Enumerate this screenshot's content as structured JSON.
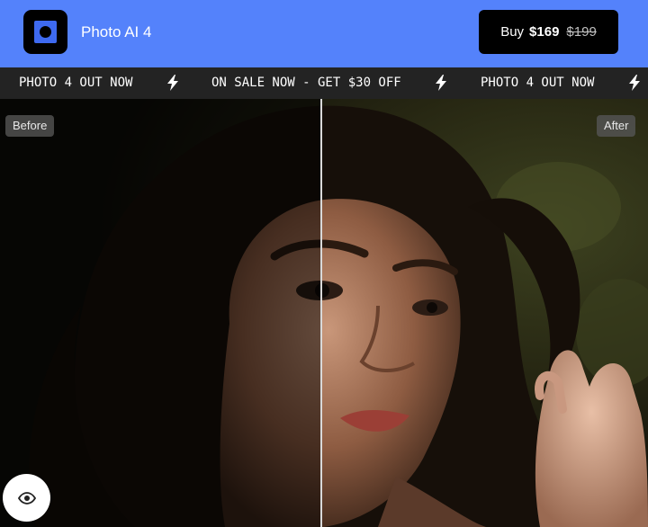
{
  "header": {
    "app_name": "Photo AI 4",
    "buy_button": {
      "label": "Buy",
      "price": "$169",
      "original_price": "$199"
    }
  },
  "ticker": {
    "items": [
      "PHOTO 4 OUT NOW",
      "ON SALE NOW - GET $30 OFF",
      "PHOTO 4 OUT NOW"
    ],
    "separator_icon": "lightning-bolt-icon"
  },
  "comparison": {
    "before_label": "Before",
    "after_label": "After",
    "toggle_icon": "eye-icon"
  },
  "colors": {
    "header_bg": "#5482fb",
    "ticker_bg": "#232323",
    "button_bg": "#000000"
  }
}
